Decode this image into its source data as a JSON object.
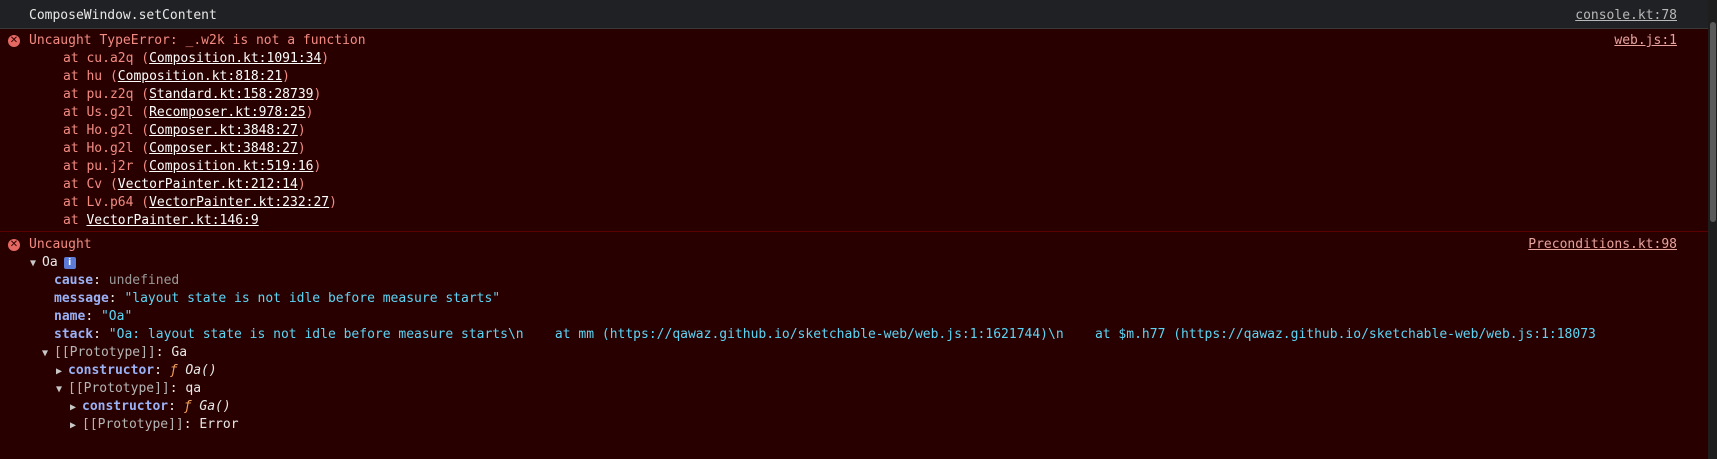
{
  "log": {
    "text": "ComposeWindow.setContent",
    "source": "console.kt:78"
  },
  "error1": {
    "message": "Uncaught TypeError: _.w2k is not a function",
    "source": "web.js:1",
    "frames": [
      {
        "fn": "cu.a2q",
        "loc": "Composition.kt:1091:34"
      },
      {
        "fn": "hu",
        "loc": "Composition.kt:818:21"
      },
      {
        "fn": "pu.z2q",
        "loc": "Standard.kt:158:28739"
      },
      {
        "fn": "Us.g2l",
        "loc": "Recomposer.kt:978:25"
      },
      {
        "fn": "Ho.g2l",
        "loc": "Composer.kt:3848:27"
      },
      {
        "fn": "Ho.g2l",
        "loc": "Composer.kt:3848:27"
      },
      {
        "fn": "pu.j2r",
        "loc": "Composition.kt:519:16"
      },
      {
        "fn": "Cv",
        "loc": "VectorPainter.kt:212:14"
      },
      {
        "fn": "Lv.p64",
        "loc": "VectorPainter.kt:232:27"
      }
    ],
    "last_frame": "VectorPainter.kt:146:9",
    "at": "at"
  },
  "error2": {
    "message": "Uncaught",
    "source": "Preconditions.kt:98",
    "object_name": "Oa",
    "info_badge": "i",
    "props": {
      "cause_key": "cause",
      "cause_val": "undefined",
      "message_key": "message",
      "message_val": "\"layout state is not idle before measure starts\"",
      "name_key": "name",
      "name_val": "\"Oa\"",
      "stack_key": "stack",
      "stack_val": "\"Oa: layout state is not idle before measure starts\\n    at mm (https://qawaz.github.io/sketchable-web/web.js:1:1621744)\\n    at $m.h77 (https://qawaz.github.io/sketchable-web/web.js:1:18073"
    },
    "proto1": {
      "key": "[[Prototype]]",
      "val": "Ga"
    },
    "ctor1": {
      "key": "constructor",
      "f": "ƒ",
      "val": "Oa()"
    },
    "proto2": {
      "key": "[[Prototype]]",
      "val": "qa"
    },
    "ctor2": {
      "key": "constructor",
      "f": "ƒ",
      "val": "Ga()"
    },
    "proto3": {
      "key": "[[Prototype]]",
      "val": "Error"
    },
    "colon": ":"
  },
  "colors": {
    "error_bg": "#290000",
    "error_text": "#f28b82",
    "string": "#5cd5f5",
    "key": "#9ab1f5"
  }
}
